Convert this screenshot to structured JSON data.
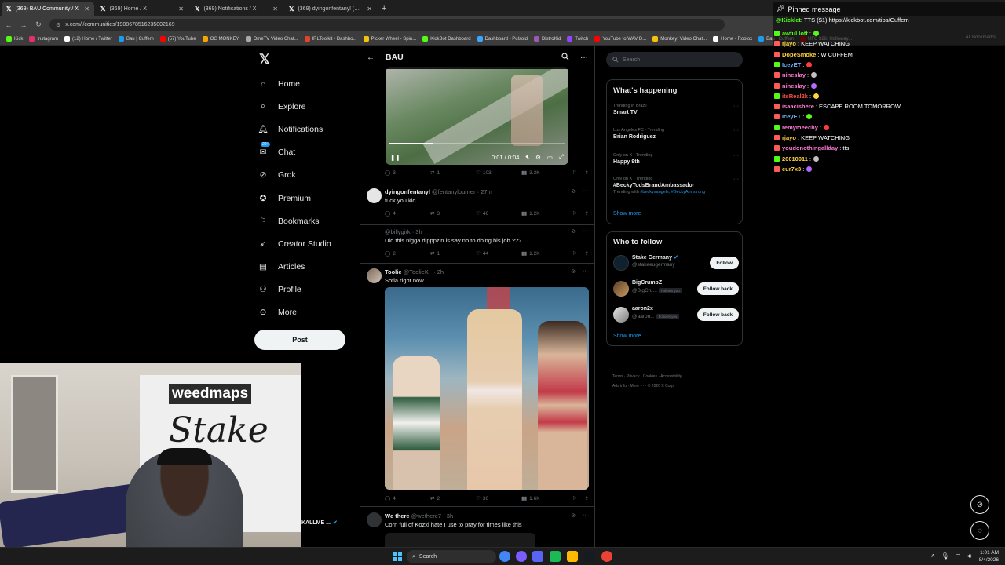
{
  "browser": {
    "tabs": [
      {
        "title": "(369) BAU Community / X",
        "active": true
      },
      {
        "title": "(369) Home / X",
        "active": false
      },
      {
        "title": "(369) Notifications / X",
        "active": false
      },
      {
        "title": "(369) dyingonfentanyl (@fent",
        "active": false
      }
    ],
    "new_tab": "+",
    "url": "x.com/i/communities/1908678516235002169",
    "bookmarks": [
      "Kick",
      "Instagram",
      "(12) Home / Twitter",
      "Bau | Cuffem",
      "(57) YouTube",
      "OG MONKEY",
      "OmeTV Video Chat...",
      "IRLToolkit • Dashbo...",
      "Picker Wheel - Spin...",
      "KickBot Dashboard",
      "Dashboard - Pulsoid",
      "DistroKid",
      "Twitch",
      "YouTube to WAV D...",
      "Monkey: Video Chat...",
      "Home - Roblox",
      "Bau | Cuffem",
      "UFC 326: Holloway..."
    ],
    "all_bookmarks": "All Bookmarks"
  },
  "nav": {
    "items": [
      {
        "label": "Home",
        "icon": "home-icon"
      },
      {
        "label": "Explore",
        "icon": "search-icon"
      },
      {
        "label": "Notifications",
        "icon": "bell-icon"
      },
      {
        "label": "Chat",
        "icon": "chat-icon"
      },
      {
        "label": "Grok",
        "icon": "grok-icon"
      },
      {
        "label": "Premium",
        "icon": "premium-icon"
      },
      {
        "label": "Bookmarks",
        "icon": "bookmark-icon"
      },
      {
        "label": "Creator Studio",
        "icon": "rocket-icon"
      },
      {
        "label": "Articles",
        "icon": "articles-icon"
      },
      {
        "label": "Profile",
        "icon": "profile-icon"
      },
      {
        "label": "More",
        "icon": "more-icon"
      }
    ],
    "chat_badge": "20+",
    "post_label": "Post"
  },
  "feed": {
    "title": "BAU",
    "video": {
      "time": "0:01 / 0:04",
      "progress": 0.25
    },
    "video_actions": {
      "replies": "3",
      "reposts": "1",
      "likes": "103",
      "views": "3.3K"
    },
    "posts": [
      {
        "name": "dyingonfentanyl",
        "handle": "@fentanylburner",
        "time": "27m",
        "text": "fuck you kid",
        "replies": "4",
        "reposts": "3",
        "likes": "46",
        "views": "1.2K"
      },
      {
        "name": "",
        "handle": "@billygirk",
        "time": "3h",
        "text": "Did this nigga dipppzin is say no to doing his job ???",
        "replies": "2",
        "reposts": "1",
        "likes": "44",
        "views": "1.2K"
      },
      {
        "name": "Toolie",
        "handle": "@ToolieK_",
        "time": "2h",
        "text": "Sofia right now",
        "replies": "4",
        "reposts": "2",
        "likes": "36",
        "views": "1.6K"
      },
      {
        "name": "We there",
        "handle": "@wethere7",
        "time": "3h",
        "text": "Corn full of Kozxi hate I use to pray for times like this"
      }
    ]
  },
  "right": {
    "search_placeholder": "Search",
    "whats_happening": "What's happening",
    "trends": [
      {
        "context": "Trending in Brazil",
        "title": "Smart TV"
      },
      {
        "context": "Los Angeles FC · Trending",
        "title": "Brian Rodriguez"
      },
      {
        "context": "Only on X · Trending",
        "title": "Happy 9th"
      },
      {
        "context": "Only on X · Trending",
        "title": "#BeckyTodsBrandAmbassador",
        "with_label": "Trending with",
        "with_tags": "#beckysangels, #BeckyArmstrong"
      }
    ],
    "show_more": "Show more",
    "who_to_follow": "Who to follow",
    "follow": [
      {
        "name": "Stake Germany",
        "handle": "@stakeeugermany",
        "button": "Follow",
        "follows_you": ""
      },
      {
        "name": "BigCrumbZ",
        "handle": "@BigCru...",
        "button": "Follow back",
        "follows_you": "Follows you"
      },
      {
        "name": "aaron2x",
        "handle": "@aaron...",
        "button": "Follow back",
        "follows_you": "Follows you"
      }
    ],
    "show_more_2": "Show more",
    "footer_1": "Terms  ·  Privacy  ·  Cookies  ·  Accessibility",
    "footer_2": "Ads info  ·  More ···  ·  © 2026 X Corp."
  },
  "chat": {
    "pinned_title": "Pinned message",
    "pinned_user": "@Kicklet",
    "pinned_text": ": TTS ($1) https://kickbot.com/tips/Cuffem",
    "lines": [
      {
        "user": "awful lott",
        "text": ":",
        "color": "#53fc18"
      },
      {
        "user": "rjayo",
        "text": ": KEEP WATCHING",
        "color": "#ffd23f"
      },
      {
        "user": "DopeSmoke",
        "text": ": W CUFFEM",
        "color": "#ffd23f"
      },
      {
        "user": "IceyET",
        "text": ":",
        "color": "#6fb7ff"
      },
      {
        "user": "nineslay",
        "text": ":",
        "color": "#ff7bd5"
      },
      {
        "user": "nineslay",
        "text": ":",
        "color": "#ff7bd5"
      },
      {
        "user": "itsReal2k",
        "text": ":",
        "color": "#ff4d4d"
      },
      {
        "user": "isaacishere",
        "text": ": ESCAPE ROOM TOMORROW",
        "color": "#ff7bd5"
      },
      {
        "user": "IceyET",
        "text": ":",
        "color": "#6fb7ff"
      },
      {
        "user": "remymeechy",
        "text": ":",
        "color": "#ff7bd5"
      },
      {
        "user": "rjayo",
        "text": ": KEEP WATCHING",
        "color": "#ffd23f"
      },
      {
        "user": "youdonothingallday",
        "text": ": tts",
        "color": "#ff7bd5"
      },
      {
        "user": "20010911",
        "text": ":",
        "color": "#ffd23f"
      },
      {
        "user": "eur7x3",
        "text": ":",
        "color": "#ffd23f"
      }
    ]
  },
  "webcam": {
    "banner_top": "weedmaps",
    "banner_main": "Stake",
    "label": "KALLME ..."
  },
  "taskbar": {
    "search_placeholder": "Search",
    "time": "1:01 AM",
    "date": "8/4/2026"
  },
  "colors": {
    "accent": "#1d9bf0",
    "kick_green": "#53fc18",
    "bg": "#000000",
    "border": "#2f3336"
  }
}
